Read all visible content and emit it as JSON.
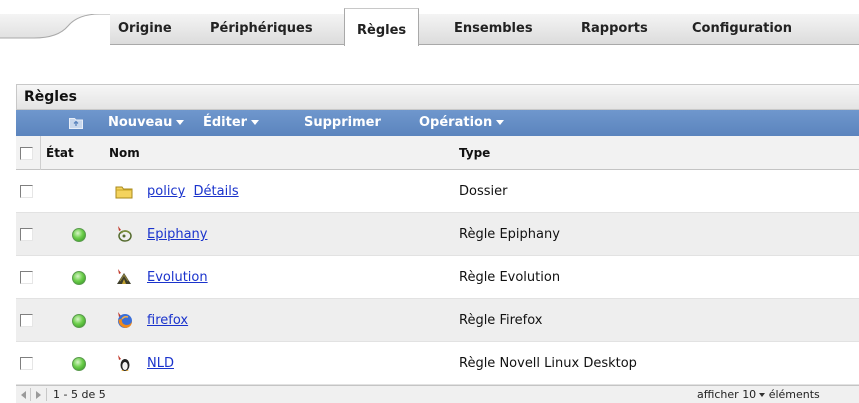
{
  "tabs": [
    {
      "label": "Origine",
      "active": false
    },
    {
      "label": "Périphériques",
      "active": false
    },
    {
      "label": "Règles",
      "active": true
    },
    {
      "label": "Ensembles",
      "active": false
    },
    {
      "label": "Rapports",
      "active": false
    },
    {
      "label": "Configuration",
      "active": false
    }
  ],
  "panel": {
    "title": "Règles",
    "toolbar": {
      "new_label": "Nouveau",
      "edit_label": "Éditer",
      "delete_label": "Supprimer",
      "operation_label": "Opération"
    },
    "columns": {
      "state": "État",
      "name": "Nom",
      "type": "Type"
    },
    "rows": [
      {
        "name": "policy",
        "detail_link": "Détails",
        "type": "Dossier",
        "icon": "folder-icon",
        "has_status": false
      },
      {
        "name": "Epiphany",
        "type": "Règle Epiphany",
        "icon": "epiphany-icon",
        "has_status": true
      },
      {
        "name": "Evolution",
        "type": "Règle Evolution",
        "icon": "evolution-icon",
        "has_status": true
      },
      {
        "name": "firefox",
        "type": "Règle Firefox",
        "icon": "firefox-icon",
        "has_status": true
      },
      {
        "name": "NLD",
        "type": "Règle Novell Linux Desktop",
        "icon": "nld-icon",
        "has_status": true
      }
    ],
    "footer": {
      "range": "1 - 5 de 5",
      "show_label": "afficher",
      "page_size": "10",
      "items_label": "éléments"
    }
  },
  "colors": {
    "toolbar_bg": "#5b84bd",
    "link": "#1a33cc",
    "status_ok": "#6dcf4c"
  }
}
